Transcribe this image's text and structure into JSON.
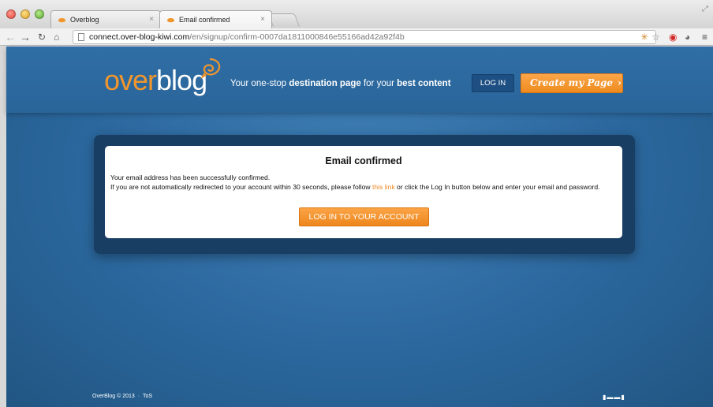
{
  "browser": {
    "tabs": [
      {
        "label": "Overblog",
        "close": "×"
      },
      {
        "label": "Email confirmed",
        "close": "×"
      }
    ],
    "url_host": "connect.over-blog-kiwi.com",
    "url_path": "/en/signup/confirm-0007da1811000846e55166ad42a92f4b"
  },
  "header": {
    "logo_prefix": "over",
    "logo_suffix": "blog",
    "tagline_1": "Your one-stop ",
    "tagline_bold_1": "destination page",
    "tagline_2": " for your ",
    "tagline_bold_2": "best content",
    "login_label": "LOG IN",
    "create_label": "Create my Page",
    "create_arrow": "›"
  },
  "confirm": {
    "title": "Email confirmed",
    "line1": "Your email address has been successfully confirmed.",
    "line2_a": "If you are not automatically redirected to your account within 30 seconds, please follow ",
    "link_text": "this link",
    "line2_b": " or click the Log In button below and enter your email and password.",
    "button_label": "LOG IN TO YOUR ACCOUNT"
  },
  "footer": {
    "copyright": "OverBlog © 2013",
    "separator": "·",
    "tos": "ToS"
  },
  "colors": {
    "accent_orange": "#ef8a22",
    "page_blue": "#2b679d"
  }
}
